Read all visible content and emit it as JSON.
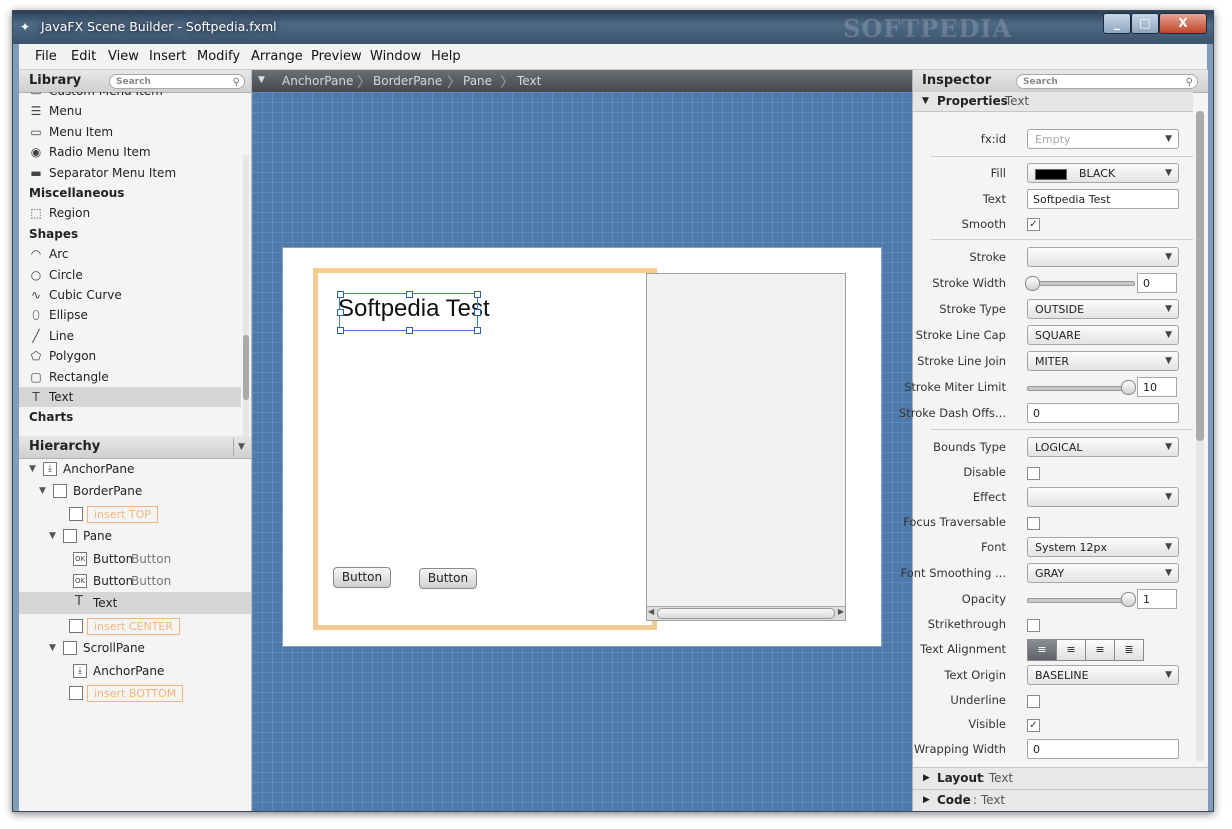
{
  "window": {
    "title": "JavaFX Scene Builder - Softpedia.fxml",
    "watermark": "SOFTPEDIA",
    "controls": {
      "minimize": "_",
      "maximize": "□",
      "close": "X"
    }
  },
  "menubar": [
    "File",
    "Edit",
    "View",
    "Insert",
    "Modify",
    "Arrange",
    "Preview",
    "Window",
    "Help"
  ],
  "library": {
    "title": "Library",
    "search_placeholder": "Search",
    "items": [
      {
        "kind": "item",
        "label": "Custom Menu Item",
        "icon": "menu-item-icon"
      },
      {
        "kind": "item",
        "label": "Menu",
        "icon": "menu-icon"
      },
      {
        "kind": "item",
        "label": "Menu Item",
        "icon": "menu-item-icon"
      },
      {
        "kind": "item",
        "label": "Radio Menu Item",
        "icon": "radio-menu-item-icon"
      },
      {
        "kind": "item",
        "label": "Separator Menu Item",
        "icon": "separator-icon"
      },
      {
        "kind": "category",
        "label": "Miscellaneous"
      },
      {
        "kind": "item",
        "label": "Region",
        "icon": "region-icon"
      },
      {
        "kind": "category",
        "label": "Shapes"
      },
      {
        "kind": "item",
        "label": "Arc",
        "icon": "arc-icon"
      },
      {
        "kind": "item",
        "label": "Circle",
        "icon": "circle-icon"
      },
      {
        "kind": "item",
        "label": "Cubic Curve",
        "icon": "cubic-curve-icon"
      },
      {
        "kind": "item",
        "label": "Ellipse",
        "icon": "ellipse-icon"
      },
      {
        "kind": "item",
        "label": "Line",
        "icon": "line-icon"
      },
      {
        "kind": "item",
        "label": "Polygon",
        "icon": "polygon-icon"
      },
      {
        "kind": "item",
        "label": "Rectangle",
        "icon": "rectangle-icon"
      },
      {
        "kind": "item",
        "label": "Text",
        "icon": "text-icon",
        "selected": true
      },
      {
        "kind": "category",
        "label": "Charts"
      }
    ]
  },
  "hierarchy": {
    "title": "Hierarchy",
    "rows": [
      {
        "label": "AnchorPane",
        "expanded": true
      },
      {
        "label": "BorderPane",
        "expanded": true
      },
      {
        "insert": "insert TOP"
      },
      {
        "label": "Pane",
        "expanded": true
      },
      {
        "label": "Button",
        "secondary": "Button"
      },
      {
        "label": "Button",
        "secondary": "Button"
      },
      {
        "label": "Text",
        "selected": true
      },
      {
        "insert": "insert CENTER"
      },
      {
        "label": "ScrollPane",
        "expanded": true
      },
      {
        "label": "AnchorPane"
      },
      {
        "insert": "insert BOTTOM"
      }
    ]
  },
  "breadcrumb": [
    "AnchorPane",
    "BorderPane",
    "Pane",
    "Text"
  ],
  "canvas": {
    "text_node": "Softpedia Test",
    "button1": "Button",
    "button2": "Button"
  },
  "inspector": {
    "title": "Inspector",
    "search_placeholder": "Search",
    "section": "Properties",
    "section_target": ": Text",
    "fx_id": {
      "label": "fx:id",
      "placeholder": "Empty"
    },
    "fill": {
      "label": "Fill",
      "value": "BLACK",
      "swatch": "#000000"
    },
    "text": {
      "label": "Text",
      "value": "Softpedia Test"
    },
    "smooth": {
      "label": "Smooth",
      "checked": true
    },
    "stroke": {
      "label": "Stroke",
      "value": ""
    },
    "stroke_width": {
      "label": "Stroke Width",
      "value": "0",
      "level": 0
    },
    "stroke_type": {
      "label": "Stroke Type",
      "value": "OUTSIDE"
    },
    "stroke_line_cap": {
      "label": "Stroke Line Cap",
      "value": "SQUARE"
    },
    "stroke_line_join": {
      "label": "Stroke Line Join",
      "value": "MITER"
    },
    "stroke_miter_limit": {
      "label": "Stroke Miter Limit",
      "value": "10",
      "level": 1
    },
    "stroke_dash_offset": {
      "label": "Stroke Dash Offs...",
      "value": "0"
    },
    "bounds_type": {
      "label": "Bounds Type",
      "value": "LOGICAL"
    },
    "disable": {
      "label": "Disable",
      "checked": false
    },
    "effect": {
      "label": "Effect",
      "value": ""
    },
    "focus_traversable": {
      "label": "Focus Traversable",
      "checked": false
    },
    "font": {
      "label": "Font",
      "value": "System 12px"
    },
    "font_smoothing": {
      "label": "Font Smoothing ...",
      "value": "GRAY"
    },
    "opacity": {
      "label": "Opacity",
      "value": "1",
      "level": 1
    },
    "strikethrough": {
      "label": "Strikethrough",
      "checked": false
    },
    "text_alignment": {
      "label": "Text Alignment",
      "selected": 0
    },
    "text_origin": {
      "label": "Text Origin",
      "value": "BASELINE"
    },
    "underline": {
      "label": "Underline",
      "checked": false
    },
    "visible": {
      "label": "Visible",
      "checked": true
    },
    "wrapping_width": {
      "label": "Wrapping Width",
      "value": "0"
    },
    "layout_section": "Layout",
    "layout_target": ": Text",
    "code_section": "Code",
    "code_target": ": Text"
  },
  "colors": {
    "canvas_blue": "#4d7aab",
    "selection_blue": "#3d7fd6",
    "insert_orange": "#f2b67a",
    "border_pane_highlight": "#f2cc93"
  }
}
